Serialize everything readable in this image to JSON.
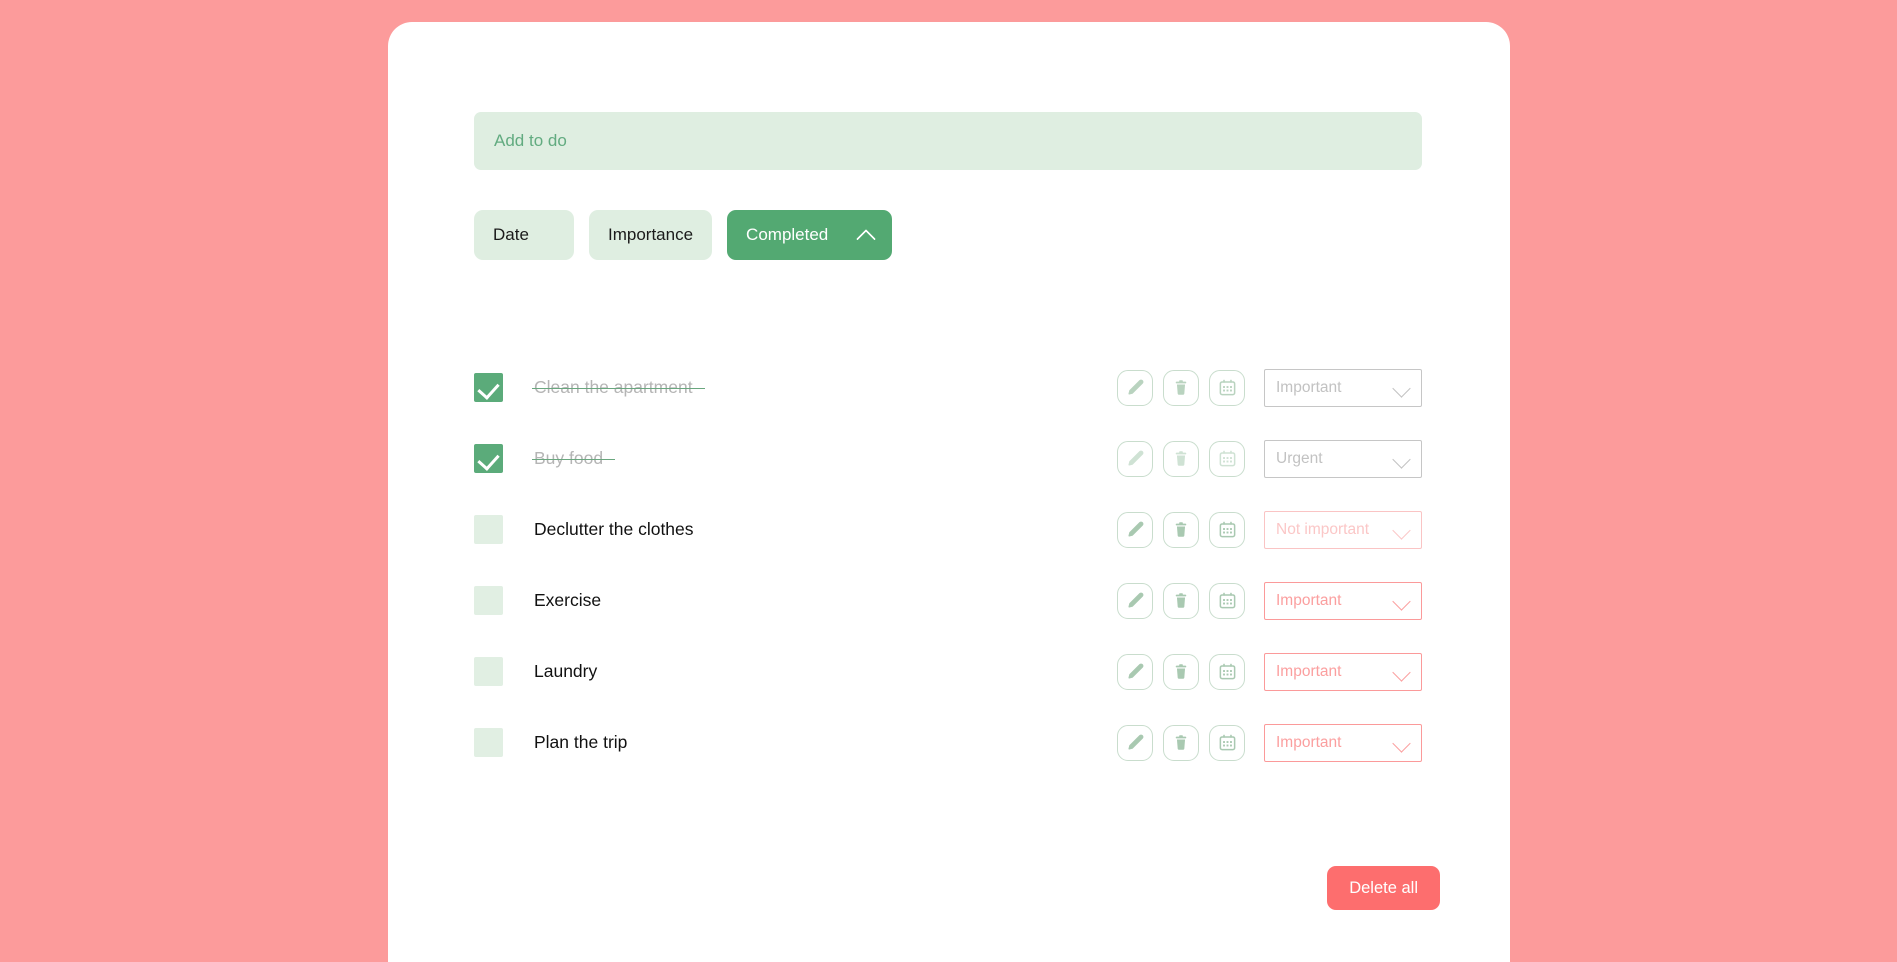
{
  "theme": {
    "page_background": "#fc9b9b",
    "card_background": "#ffffff",
    "accent_green": "#53a972",
    "soft_green": "#dfeee1",
    "danger": "#fd6e6e",
    "pink_soft": "#fac4c4",
    "pink_strong": "#fb9a9a"
  },
  "add_todo": {
    "placeholder": "Add to do",
    "value": ""
  },
  "filters": [
    {
      "label": "Date",
      "active": false,
      "icon": ""
    },
    {
      "label": "Importance",
      "active": false,
      "icon": ""
    },
    {
      "label": "Completed",
      "active": true,
      "icon": "chevron-up-icon"
    }
  ],
  "todos": [
    {
      "title": "Clean the apartment",
      "completed": true,
      "priority": "Important",
      "priority_style": "grey",
      "actions": [
        "edit-icon",
        "delete-icon",
        "calendar-icon"
      ]
    },
    {
      "title": "Buy food",
      "completed": true,
      "priority": "Urgent",
      "priority_style": "grey",
      "actions": [
        "edit-icon",
        "delete-icon",
        "calendar-icon"
      ]
    },
    {
      "title": "Declutter the clothes",
      "completed": false,
      "priority": "Not important",
      "priority_style": "pink-soft",
      "actions": [
        "edit-icon",
        "delete-icon",
        "calendar-icon"
      ]
    },
    {
      "title": "Exercise",
      "completed": false,
      "priority": "Important",
      "priority_style": "pink-strong",
      "actions": [
        "edit-icon",
        "delete-icon",
        "calendar-icon"
      ]
    },
    {
      "title": "Laundry",
      "completed": false,
      "priority": "Important",
      "priority_style": "pink-strong",
      "actions": [
        "edit-icon",
        "delete-icon",
        "calendar-icon"
      ]
    },
    {
      "title": "Plan the trip",
      "completed": false,
      "priority": "Important",
      "priority_style": "pink-strong",
      "actions": [
        "edit-icon",
        "delete-icon",
        "calendar-icon"
      ]
    }
  ],
  "delete_all": {
    "label": "Delete all"
  }
}
